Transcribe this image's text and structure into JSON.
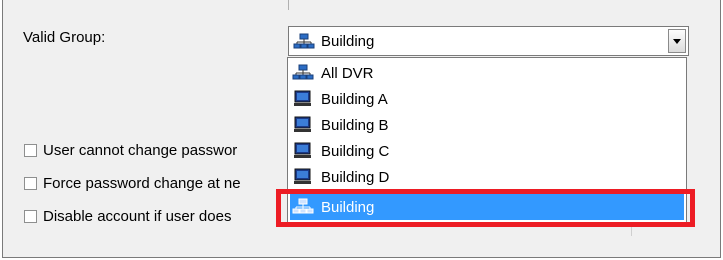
{
  "form": {
    "valid_group_label": "Valid Group:",
    "valid_group_value": "Building",
    "checkboxes": [
      {
        "label": "User cannot change passwor",
        "checked": false
      },
      {
        "label": "Force password change at ne",
        "checked": false
      },
      {
        "label": "Disable account if user does",
        "checked": false
      }
    ]
  },
  "dropdown": {
    "items": [
      {
        "label": "All DVR",
        "icon": "group-network-icon"
      },
      {
        "label": "Building A",
        "icon": "monitor-icon"
      },
      {
        "label": "Building B",
        "icon": "monitor-icon"
      },
      {
        "label": "Building C",
        "icon": "monitor-icon"
      },
      {
        "label": "Building D",
        "icon": "monitor-icon"
      },
      {
        "label": "Building",
        "icon": "group-network-icon",
        "selected": true
      }
    ]
  },
  "colors": {
    "selection": "#3399ff",
    "highlight_border": "#ed1c24",
    "background": "#f0f0f0"
  }
}
